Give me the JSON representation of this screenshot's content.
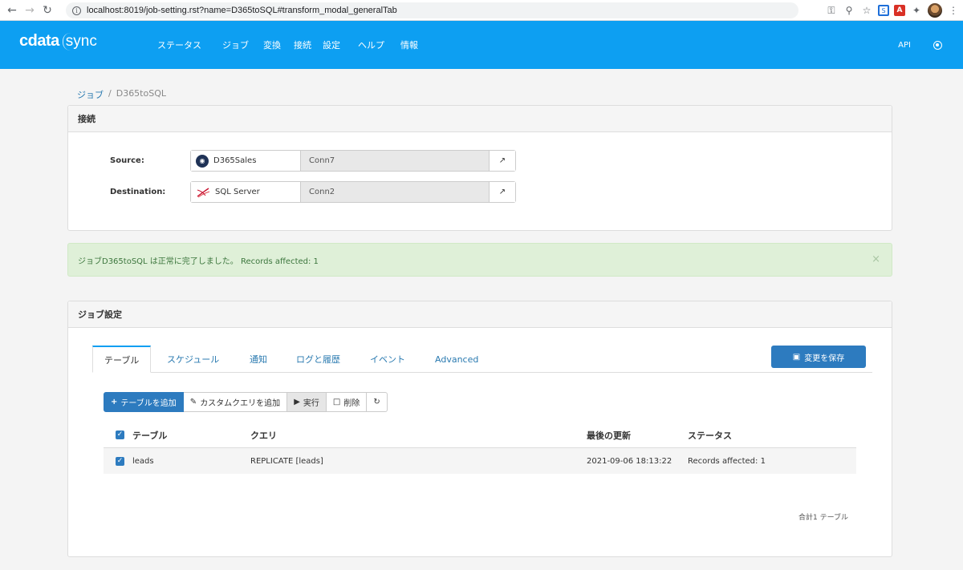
{
  "browser": {
    "url": "localhost:8019/job-setting.rst?name=D365toSQL#transform_modal_generalTab"
  },
  "header": {
    "logo_main": "cdata",
    "logo_sub": "sync",
    "nav": [
      "ステータス",
      "ジョブ",
      "変換",
      "接続",
      "設定",
      "ヘルプ",
      "情報"
    ],
    "api_label": "API"
  },
  "breadcrumb": {
    "parent": "ジョブ",
    "separator": "/",
    "current": "D365toSQL"
  },
  "connection_panel": {
    "title": "接続",
    "source": {
      "label": "Source:",
      "type": "D365Sales",
      "name": "Conn7"
    },
    "destination": {
      "label": "Destination:",
      "type": "SQL Server",
      "name": "Conn2"
    }
  },
  "alert": {
    "message": "ジョブD365toSQL は正常に完了しました。 Records affected: 1",
    "close": "×"
  },
  "job_panel": {
    "title": "ジョブ設定",
    "tabs": [
      "テーブル",
      "スケジュール",
      "通知",
      "ログと履歴",
      "イベント",
      "Advanced"
    ],
    "save_label": "変更を保存",
    "toolbar": {
      "add_table": "テーブルを追加",
      "add_query": "カスタムクエリを追加",
      "run": "実行",
      "delete": "削除"
    },
    "columns": {
      "table": "テーブル",
      "query": "クエリ",
      "updated": "最後の更新",
      "status": "ステータス"
    },
    "rows": [
      {
        "table": "leads",
        "query": "REPLICATE [leads]",
        "updated": "2021-09-06 18:13:22",
        "status": "Records affected: 1"
      }
    ],
    "total": "合計1 テーブル"
  },
  "colors": {
    "header_bg": "#0d9ff2",
    "primary_button": "#2d7bbf",
    "success_bg": "#dff0d8",
    "success_text": "#3c763d"
  }
}
